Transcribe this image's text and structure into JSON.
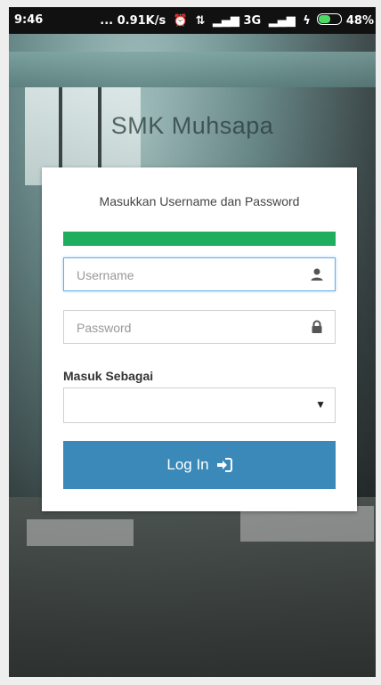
{
  "status_bar": {
    "time": "9:46",
    "network_speed": "... 0.91K/s",
    "network_type": "3G",
    "battery_percent": "48%",
    "icons": [
      "alarm-icon",
      "data-arrows-icon",
      "signal-icon",
      "signal-icon-2",
      "charging-icon",
      "battery-icon"
    ]
  },
  "app": {
    "brand": "SMK Muhsapa"
  },
  "login_card": {
    "subtitle": "Masukkan Username dan Password",
    "progress_fraction": 1.0,
    "progress_color": "#1fae5d",
    "username": {
      "placeholder": "Username",
      "value": "",
      "icon": "user-icon"
    },
    "password": {
      "placeholder": "Password",
      "value": "",
      "icon": "lock-icon"
    },
    "role_label": "Masuk Sebagai",
    "role_select": {
      "selected": ""
    },
    "login_button": {
      "label": "Log In",
      "icon": "sign-in-icon",
      "color": "#3a89b8"
    }
  }
}
